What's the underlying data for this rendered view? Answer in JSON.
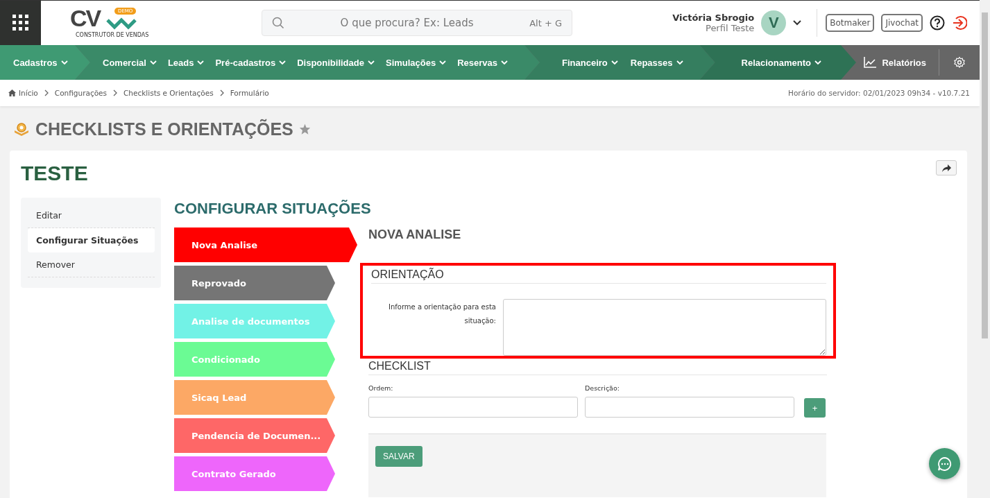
{
  "header": {
    "logo": {
      "text": "CV",
      "badge": "DEMO",
      "tagline": "CONSTRUTOR DE VENDAS"
    },
    "search": {
      "placeholder": "O que procura? Ex: Leads",
      "shortcut": "Alt + G"
    },
    "user": {
      "name": "Victória Sbrogio",
      "profile": "Perfil Teste",
      "initial": "V"
    },
    "buttons": [
      "Botmaker",
      "Jivochat"
    ]
  },
  "nav": {
    "groups": [
      {
        "color": "#3f9a73",
        "items": [
          "Cadastros"
        ]
      },
      {
        "color": "#3a8a68",
        "items": [
          "Comercial",
          "Leads",
          "Pré-cadastros",
          "Disponibilidade",
          "Simulações",
          "Reservas"
        ]
      },
      {
        "color": "#357e5f",
        "items": [
          "Financeiro",
          "Repasses"
        ]
      },
      {
        "color": "#2e7255",
        "items": [
          "Relacionamento"
        ]
      }
    ],
    "reports": "Relatórios"
  },
  "breadcrumb": {
    "items": [
      "Início",
      "Configurações",
      "Checklists e Orientações",
      "Formulário"
    ],
    "server_info": "Horário do servidor: 02/01/2023 09h34 - v10.7.21"
  },
  "page_title": "CHECKLISTS E ORIENTAÇÕES",
  "record": {
    "title": "TESTE",
    "menu": [
      {
        "label": "Editar",
        "selected": false
      },
      {
        "label": "Configurar Situações",
        "selected": true
      },
      {
        "label": "Remover",
        "selected": false
      }
    ],
    "section_title": "CONFIGURAR SITUAÇÕES",
    "situations": [
      {
        "label": "Nova Analise",
        "color": "#ff0000",
        "selected": true
      },
      {
        "label": "Reprovado",
        "color": "#757575",
        "selected": false
      },
      {
        "label": "Analise de documentos",
        "color": "#72f2e6",
        "selected": false
      },
      {
        "label": "Condicionado",
        "color": "#6bfb94",
        "selected": false
      },
      {
        "label": "Sicaq Lead",
        "color": "#fca865",
        "selected": false
      },
      {
        "label": "Pendencia de Documen...",
        "color": "#fe6767",
        "selected": false
      },
      {
        "label": "Contrato Gerado",
        "color": "#ee66fb",
        "selected": false
      }
    ],
    "form": {
      "title": "NOVA ANALISE",
      "orientation": {
        "heading": "ORIENTAÇÃO",
        "highlighted": true,
        "label": "Informe a orientação para esta situação:"
      },
      "checklist": {
        "heading": "CHECKLIST",
        "fields": [
          {
            "label": "Ordem:"
          },
          {
            "label": "Descrição:"
          }
        ],
        "add_button": "+"
      },
      "save_button": "SALVAR"
    }
  }
}
